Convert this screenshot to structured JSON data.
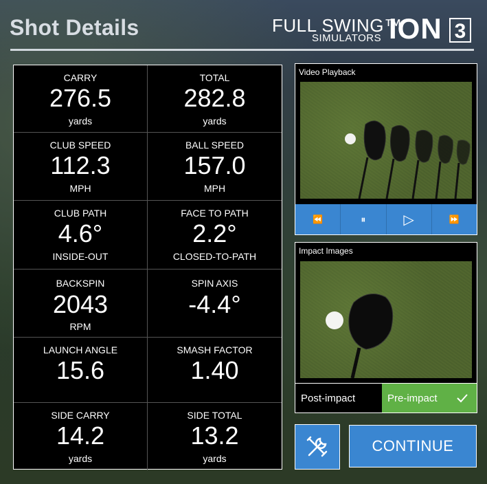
{
  "header": {
    "title": "Shot Details",
    "logo": {
      "line1": "FULL SWING™",
      "line2": "SIMULATORS",
      "brand": "ION",
      "edition": "3"
    }
  },
  "metrics": [
    {
      "label": "CARRY",
      "value": "276.5",
      "unit": "yards"
    },
    {
      "label": "TOTAL",
      "value": "282.8",
      "unit": "yards"
    },
    {
      "label": "CLUB SPEED",
      "value": "112.3",
      "unit": "MPH"
    },
    {
      "label": "BALL SPEED",
      "value": "157.0",
      "unit": "MPH"
    },
    {
      "label": "CLUB PATH",
      "value": "4.6°",
      "unit": "INSIDE-OUT"
    },
    {
      "label": "FACE TO PATH",
      "value": "2.2°",
      "unit": "CLOSED-TO-PATH"
    },
    {
      "label": "BACKSPIN",
      "value": "2043",
      "unit": "RPM"
    },
    {
      "label": "SPIN AXIS",
      "value": "-4.4°",
      "unit": ""
    },
    {
      "label": "LAUNCH ANGLE",
      "value": "15.6",
      "unit": ""
    },
    {
      "label": "SMASH FACTOR",
      "value": "1.40",
      "unit": ""
    },
    {
      "label": "SIDE CARRY",
      "value": "14.2",
      "unit": "yards"
    },
    {
      "label": "SIDE TOTAL",
      "value": "13.2",
      "unit": "yards"
    }
  ],
  "video": {
    "title": "Video Playback",
    "controls": [
      {
        "name": "rewind",
        "glyph": "⏪"
      },
      {
        "name": "pause",
        "glyph": "⏸"
      },
      {
        "name": "play",
        "glyph": "▷"
      },
      {
        "name": "fast-forward",
        "glyph": "⏩"
      }
    ]
  },
  "impact": {
    "title": "Impact Images",
    "post_label": "Post-impact",
    "pre_label": "Pre-impact",
    "selected": "Pre-impact"
  },
  "actions": {
    "continue_label": "CONTINUE",
    "tools_icon": "tools-icon"
  },
  "colors": {
    "accent_blue": "#3a86d1",
    "active_green": "#60b146"
  }
}
